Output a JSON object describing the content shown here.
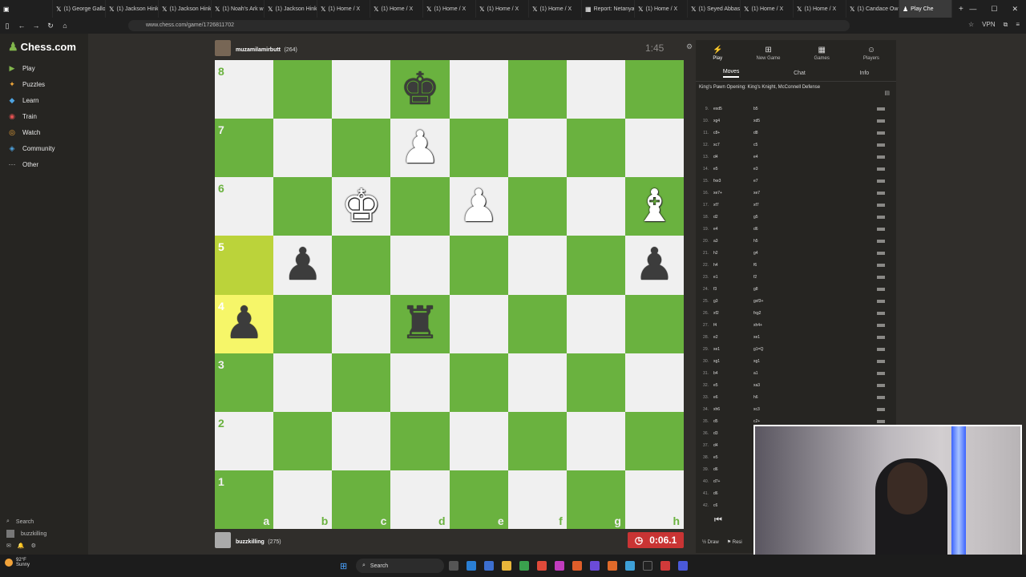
{
  "browser": {
    "tabs": [
      {
        "label": "(1) George Gallo",
        "icon": "x-logo-icon"
      },
      {
        "label": "(1) Jackson Hink",
        "icon": "x-logo-icon"
      },
      {
        "label": "(1) Jackson Hink",
        "icon": "x-logo-icon"
      },
      {
        "label": "(1) Noah's Ark w",
        "icon": "x-logo-icon"
      },
      {
        "label": "(1) Jackson Hink",
        "icon": "x-logo-icon"
      },
      {
        "label": "(1) Home / X",
        "icon": "x-logo-icon"
      },
      {
        "label": "(1) Home / X",
        "icon": "x-logo-icon"
      },
      {
        "label": "(1) Home / X",
        "icon": "x-logo-icon"
      },
      {
        "label": "(1) Home / X",
        "icon": "x-logo-icon"
      },
      {
        "label": "(1) Home / X",
        "icon": "x-logo-icon"
      },
      {
        "label": "Report: Netanya",
        "icon": "news-icon"
      },
      {
        "label": "(1) Home / X",
        "icon": "x-logo-icon"
      },
      {
        "label": "(1) Seyed Abbas",
        "icon": "x-logo-icon"
      },
      {
        "label": "(1) Home / X",
        "icon": "x-logo-icon"
      },
      {
        "label": "(1) Home / X",
        "icon": "x-logo-icon"
      },
      {
        "label": "(1) Candace Ow",
        "icon": "x-logo-icon"
      },
      {
        "label": "Play Che",
        "icon": "chess-pawn-icon",
        "active": true
      }
    ],
    "url": "www.chess.com/game/1726811702"
  },
  "sidebar": {
    "logo": "Chess.com",
    "items": [
      {
        "label": "Play",
        "icon": "play-icon",
        "color": "#81b64c"
      },
      {
        "label": "Puzzles",
        "icon": "puzzle-icon",
        "color": "#f0a73a"
      },
      {
        "label": "Learn",
        "icon": "learn-icon",
        "color": "#4ea3e0"
      },
      {
        "label": "Train",
        "icon": "train-icon",
        "color": "#e05151"
      },
      {
        "label": "Watch",
        "icon": "watch-icon",
        "color": "#f0a73a"
      },
      {
        "label": "Community",
        "icon": "community-icon",
        "color": "#4ea3e0"
      },
      {
        "label": "Other",
        "icon": "more-icon",
        "color": "#bbbbbb"
      }
    ],
    "search_label": "Search",
    "username": "buzzkilling"
  },
  "game": {
    "top_player": {
      "name": "muzamilamirbutt",
      "rating": "(264)",
      "clock": "1:45"
    },
    "bottom_player": {
      "name": "buzzkilling",
      "rating": "(275)",
      "clock": "0:06.1"
    },
    "files": [
      "a",
      "b",
      "c",
      "d",
      "e",
      "f",
      "g",
      "h"
    ],
    "ranks": [
      "8",
      "7",
      "6",
      "5",
      "4",
      "3",
      "2",
      "1"
    ],
    "pieces": [
      {
        "square": "d8",
        "glyph": "♚",
        "color": "b",
        "name": "black-king"
      },
      {
        "square": "d7",
        "glyph": "♟",
        "color": "w",
        "name": "white-pawn"
      },
      {
        "square": "c6",
        "glyph": "♚",
        "color": "w",
        "name": "white-king"
      },
      {
        "square": "e6",
        "glyph": "♟",
        "color": "w",
        "name": "white-pawn"
      },
      {
        "square": "h6",
        "glyph": "♝",
        "color": "w",
        "name": "white-bishop"
      },
      {
        "square": "b5",
        "glyph": "♟",
        "color": "b",
        "name": "black-pawn"
      },
      {
        "square": "h5",
        "glyph": "♟",
        "color": "b",
        "name": "black-pawn"
      },
      {
        "square": "a4",
        "glyph": "♟",
        "color": "b",
        "name": "black-pawn"
      },
      {
        "square": "d4",
        "glyph": "♜",
        "color": "b",
        "name": "black-rook"
      }
    ],
    "highlighted": [
      "a5",
      "a4"
    ]
  },
  "panel": {
    "tabs": [
      {
        "label": "Play",
        "icon": "play-icon",
        "active": true
      },
      {
        "label": "New Game",
        "icon": "plus-icon"
      },
      {
        "label": "Games",
        "icon": "games-icon"
      },
      {
        "label": "Players",
        "icon": "players-icon"
      }
    ],
    "sub_tabs": [
      "Moves",
      "Chat",
      "Info"
    ],
    "opening": "King's Pawn Opening: King's Knight, McConnell Defense",
    "moves": [
      [
        "9.",
        "exd5",
        "b5"
      ],
      [
        "10.",
        "xg4",
        "xd5"
      ],
      [
        "11.",
        "c8+",
        "d8"
      ],
      [
        "12.",
        "xc7",
        "c5"
      ],
      [
        "13.",
        "d4",
        "e4"
      ],
      [
        "14.",
        "e5",
        "e3"
      ],
      [
        "15.",
        "fxe3",
        "e7"
      ],
      [
        "16.",
        "xe7+",
        "xe7"
      ],
      [
        "17.",
        "xf7",
        "xf7"
      ],
      [
        "18.",
        "d2",
        "g5"
      ],
      [
        "19.",
        "e4",
        "d6"
      ],
      [
        "20.",
        "a3",
        "h5"
      ],
      [
        "21.",
        "h2",
        "g4"
      ],
      [
        "22.",
        "h4",
        "f6"
      ],
      [
        "23.",
        "e1",
        "f2"
      ],
      [
        "24.",
        "f3",
        "g8"
      ],
      [
        "25.",
        "g3",
        "gxf3+"
      ],
      [
        "26.",
        "xf2",
        "fxg2"
      ],
      [
        "27.",
        "f4",
        "xh4+"
      ],
      [
        "28.",
        "e2",
        "xe1"
      ],
      [
        "29.",
        "xe1",
        "g1=Q"
      ],
      [
        "30.",
        "xg1",
        "xg1"
      ],
      [
        "31.",
        "b4",
        "a1"
      ],
      [
        "32.",
        "e5",
        "xa3"
      ],
      [
        "33.",
        "e6",
        "h6"
      ],
      [
        "34.",
        "xh6",
        "xc3"
      ],
      [
        "35.",
        "d5",
        "c2+"
      ],
      [
        "36.",
        "d3",
        ""
      ],
      [
        "37.",
        "d4",
        ""
      ],
      [
        "38.",
        "e5",
        ""
      ],
      [
        "39.",
        "d6",
        ""
      ],
      [
        "40.",
        "d7+",
        ""
      ],
      [
        "41.",
        "d6",
        ""
      ],
      [
        "42.",
        "c6",
        ""
      ]
    ],
    "draw_label": "Draw",
    "resign_label": "Resi"
  },
  "taskbar": {
    "weather_temp": "92°F",
    "weather_desc": "Sunny",
    "search_label": "Search"
  }
}
